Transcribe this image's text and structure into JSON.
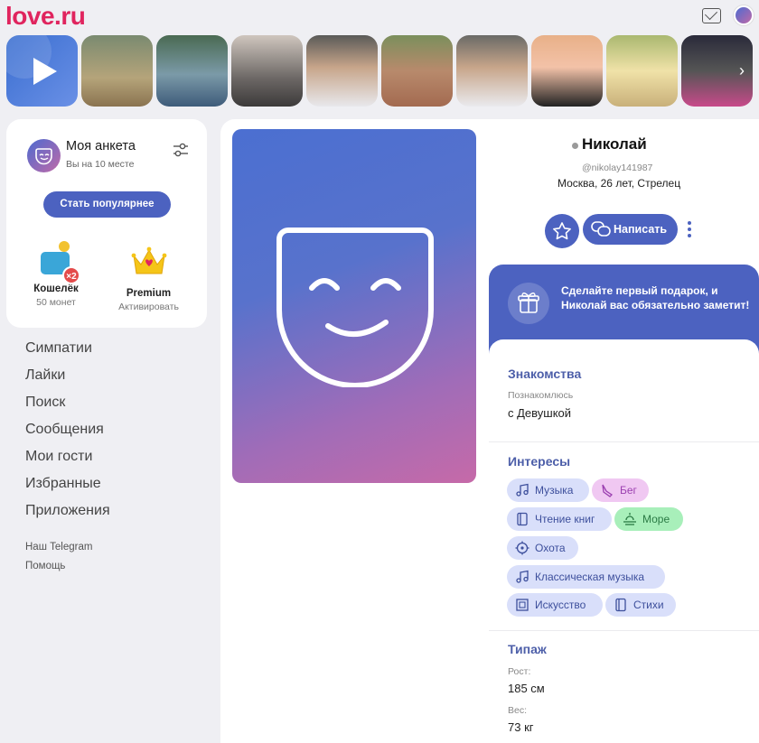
{
  "header": {
    "logo": "lo",
    "logo_rest": "ve.ru",
    "mail_icon": "envelope-icon",
    "avatar_icon": "mask-avatar-icon"
  },
  "stories": {
    "next_icon": "chevron-right-icon",
    "count": 10
  },
  "my_card": {
    "title": "Моя анкета",
    "subtitle": "Вы на 10 месте",
    "settings_icon": "sliders-icon",
    "popular_button": "Стать популярнее",
    "wallet": {
      "label": "Кошелёк",
      "value": "50 монет",
      "badge": "×2"
    },
    "premium": {
      "label": "Premium",
      "value": "Активировать"
    }
  },
  "menu": {
    "items": [
      "Симпатии",
      "Лайки",
      "Поиск",
      "Сообщения",
      "Мои гости",
      "Избранные",
      "Приложения"
    ],
    "telegram": "Наш Telegram",
    "help": "Помощь"
  },
  "profile": {
    "name": "Николай",
    "nick": "@nikolay141987",
    "city_line": "Москва, 26 лет, Стрелец",
    "write_button": "Написать",
    "gift_text": "Сделайте первый подарок, и Николай вас обязательно заметит!",
    "dating": {
      "title": "Знакомства",
      "label": "Познакомлюсь",
      "value": "с Девушкой"
    },
    "interests": {
      "title": "Интересы",
      "tags": [
        "Музыка",
        "Бег",
        "Чтение книг",
        "Море",
        "Охота",
        "Классическая музыка",
        "Искусство",
        "Стихи"
      ]
    },
    "type": {
      "title": "Типаж",
      "height_label": "Рост:",
      "height_value": "185 см",
      "weight_label": "Вес:",
      "weight_value": "73 кг"
    }
  },
  "colors": {
    "brand": "#e0245e",
    "accent": "#4c62c0",
    "tag_bg": "#d9dffa",
    "tag_purple": "#f0c8f2",
    "tag_green": "#a8efba"
  }
}
